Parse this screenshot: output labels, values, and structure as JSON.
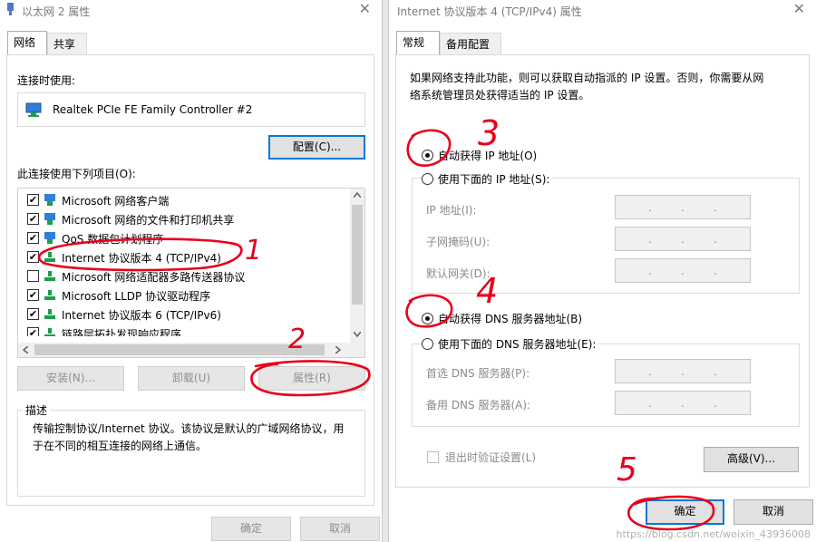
{
  "left_window": {
    "title": "以太网 2 属性",
    "close_glyph": "✕",
    "tabs": [
      "网络",
      "共享"
    ],
    "connect_using_label": "连接时使用:",
    "adapter_name": "Realtek PCIe FE Family Controller #2",
    "configure_button": "配置(C)...",
    "items_label": "此连接使用下列项目(O):",
    "items": [
      {
        "text": "Microsoft 网络客户端",
        "checked": true
      },
      {
        "text": "Microsoft 网络的文件和打印机共享",
        "checked": true
      },
      {
        "text": "QoS 数据包计划程序",
        "checked": true
      },
      {
        "text": "Internet 协议版本 4 (TCP/IPv4)",
        "checked": true
      },
      {
        "text": "Microsoft 网络适配器多路传送器协议",
        "checked": false
      },
      {
        "text": "Microsoft LLDP 协议驱动程序",
        "checked": true
      },
      {
        "text": "Internet 协议版本 6 (TCP/IPv6)",
        "checked": true
      },
      {
        "text": "链路层拓扑发现响应程序",
        "checked": true
      }
    ],
    "install_button": "安装(N)...",
    "uninstall_button": "卸载(U)",
    "properties_button": "属性(R)",
    "description_title": "描述",
    "description_line1": "传输控制协议/Internet 协议。该协议是默认的广域网络协议，用",
    "description_line2": "于在不同的相互连接的网络上通信。",
    "ok_button": "确定",
    "cancel_button": "取消"
  },
  "right_window": {
    "title": "Internet 协议版本 4 (TCP/IPv4) 属性",
    "close_glyph": "✕",
    "tabs": [
      "常规",
      "备用配置"
    ],
    "intro_line1": "如果网络支持此功能，则可以获取自动指派的 IP 设置。否则，你需要从网",
    "intro_line2": "络系统管理员处获得适当的 IP 设置。",
    "auto_ip_radio": "自动获得 IP 地址(O)",
    "manual_ip_radio": "使用下面的 IP 地址(S):",
    "ip_address_label": "IP 地址(I):",
    "subnet_label": "子网掩码(U):",
    "gateway_label": "默认网关(D):",
    "auto_dns_radio": "自动获得 DNS 服务器地址(B)",
    "manual_dns_radio": "使用下面的 DNS 服务器地址(E):",
    "preferred_dns_label": "首选 DNS 服务器(P):",
    "alternate_dns_label": "备用 DNS 服务器(A):",
    "ip_dot": ".",
    "validate_checkbox": "退出时验证设置(L)",
    "advanced_button": "高级(V)...",
    "ok_button": "确定",
    "cancel_button": "取消",
    "auto_ip_selected": true,
    "auto_dns_selected": true
  },
  "annotations": {
    "step1": "1",
    "step2": "2",
    "step3": "3",
    "step4": "4",
    "step5": "5",
    "ink_color": "#e8001c"
  },
  "watermark": "https://blog.csdn.net/weixin_43936008"
}
